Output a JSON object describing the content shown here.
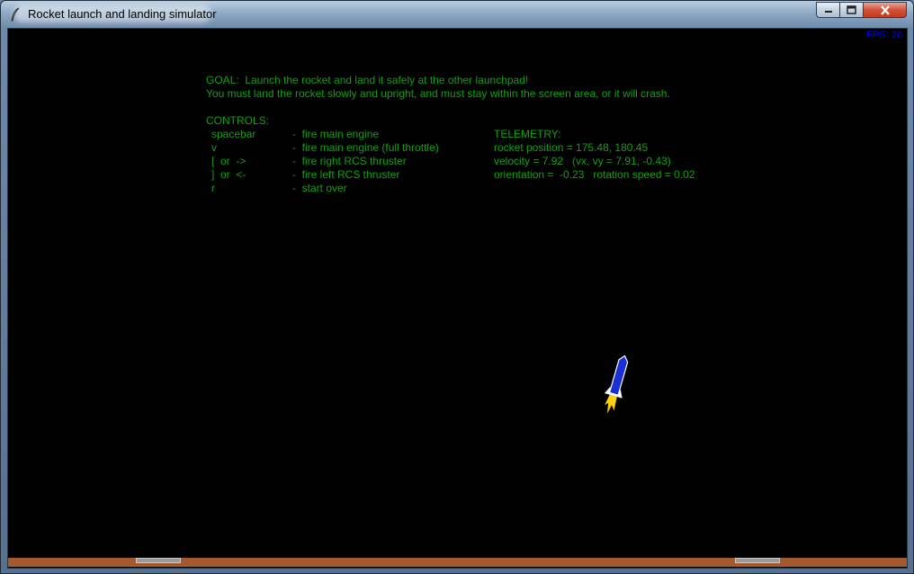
{
  "window": {
    "title": "Rocket launch and landing simulator"
  },
  "hud": {
    "fps": "FPS: 26"
  },
  "goal": {
    "line1": "GOAL:  Launch the rocket and land it safely at the other launchpad!",
    "line2": "You must land the rocket slowly and upright, and must stay within the screen area, or it will crash."
  },
  "controls": {
    "heading": "CONTROLS:",
    "items": [
      {
        "key": "spacebar",
        "action": "-  fire main engine"
      },
      {
        "key": "v",
        "action": "-  fire main engine (full throttle)"
      },
      {
        "key": "[  or  ->",
        "action": "-  fire right RCS thruster"
      },
      {
        "key": "]  or  <-",
        "action": "-  fire left RCS thruster"
      },
      {
        "key": "r",
        "action": "-  start over"
      }
    ]
  },
  "telemetry": {
    "heading": "TELEMETRY:",
    "position": "rocket position = 175.48, 180.45",
    "velocity": "velocity = 7.92   (vx, vy = 7.91, -0.43)",
    "orientation": "orientation =  -0.23   rotation speed = 0.02"
  },
  "colors": {
    "text": "#12a012",
    "fps": "#0000ff",
    "ground": "#a55a2e",
    "rocket_body": "#1a2fd6",
    "flame": "#ffd21a",
    "background": "#000000"
  },
  "icons": {
    "app": "feather-icon",
    "minimize": "minimize-icon",
    "maximize": "maximize-icon",
    "close": "close-icon"
  }
}
